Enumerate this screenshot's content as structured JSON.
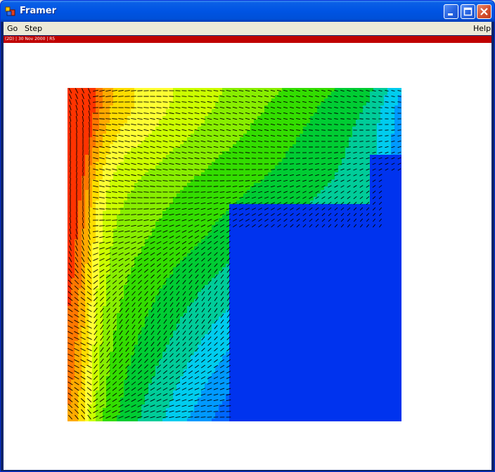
{
  "window": {
    "title": "Framer",
    "frame_color": "#0054e3"
  },
  "menu": {
    "items": [
      "Go",
      "Step"
    ],
    "help": "Help"
  },
  "status": {
    "text": "(2D)  |  30 Nov 2000  |  R5",
    "color": "#c00000"
  },
  "plot": {
    "type": "contour-with-vector-field",
    "palette": [
      "#ff3300",
      "#ff7700",
      "#ffaa00",
      "#ffdd00",
      "#ffff33",
      "#ccff00",
      "#88ee00",
      "#33dd00",
      "#00cc33",
      "#00cc99",
      "#00ccee",
      "#0099ff",
      "#0066ff",
      "#0033ee"
    ],
    "arrow_color": "#000000",
    "background_color": "#ffffff"
  },
  "icons": {
    "app": "framer-app-icon",
    "minimize": "minimize-icon",
    "maximize": "maximize-icon",
    "close": "close-icon"
  }
}
